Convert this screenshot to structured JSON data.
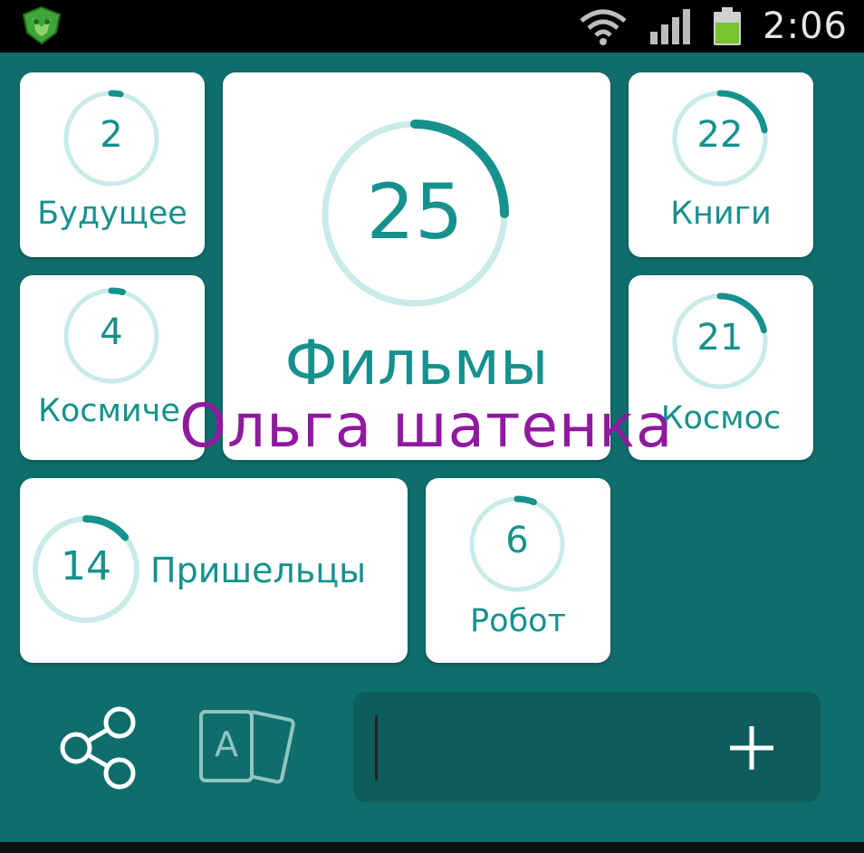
{
  "status_bar": {
    "time": "2:06",
    "icons": [
      "app-logo-icon",
      "wifi-icon",
      "signal-icon",
      "battery-icon"
    ],
    "battery_color": "#7ac52c"
  },
  "tiles": [
    {
      "id": "budushchee",
      "value": "2",
      "label": "Будущее",
      "progress": 0.02
    },
    {
      "id": "filmy",
      "value": "25",
      "label": "Фильмы",
      "progress": 0.25
    },
    {
      "id": "knigi",
      "value": "22",
      "label": "Книги",
      "progress": 0.22
    },
    {
      "id": "kosmicheskiy",
      "value": "4",
      "label": "Космиче",
      "progress": 0.04
    },
    {
      "id": "kosmos",
      "value": "21",
      "label": "Космос",
      "progress": 0.21
    },
    {
      "id": "prishelcy",
      "value": "14",
      "label": "Пришельцы",
      "progress": 0.14
    },
    {
      "id": "robot",
      "value": "6",
      "label": "Робот",
      "progress": 0.06
    }
  ],
  "toolbar": {
    "share_icon": "share-icon",
    "cards_icon": "cards-icon",
    "cards_letter": "A",
    "add_icon": "plus-icon"
  },
  "watermark": "Ольга шатенка",
  "colors": {
    "background": "#0f6e6b",
    "accent": "#16918d",
    "ring_track": "#c9ebe9",
    "watermark": "#8e1a9e"
  }
}
